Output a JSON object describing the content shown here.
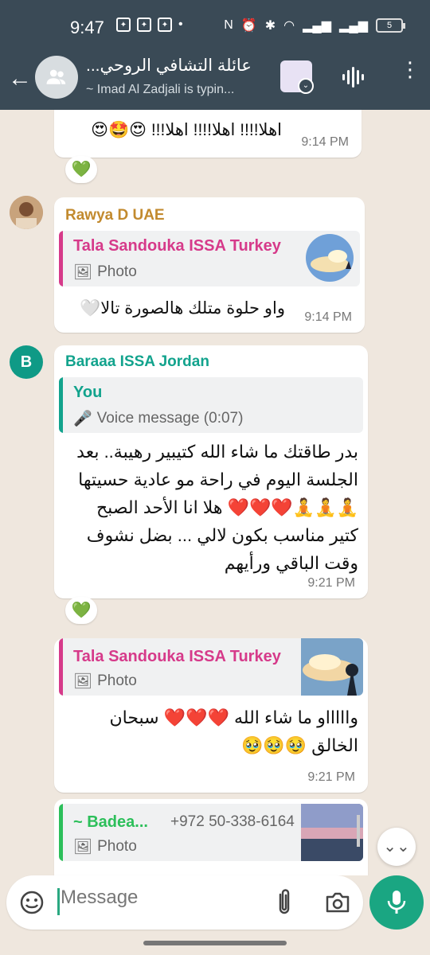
{
  "status_bar": {
    "time": "9:47",
    "battery": "5"
  },
  "header": {
    "title": "عائلة التشافي الروحي...",
    "subtitle": "~ Imad Al Zadjali is typin..."
  },
  "messages": [
    {
      "text": "اهلا!!!! اهلا!!!! اهلا!!! 😍🤩😍",
      "time": "9:14 PM",
      "reaction": "💚"
    },
    {
      "sender": "Rawya D UAE",
      "sender_color": "#c28a2e",
      "quote": {
        "name": "Tala Sandouka ISSA Turkey",
        "type_label": "Photo"
      },
      "text": "واو حلوة متلك هالصورة تالا🤍",
      "time": "9:14 PM"
    },
    {
      "sender": "Baraaa ISSA Jordan",
      "avatar_letter": "B",
      "sender_color": "#12a38d",
      "quote": {
        "name": "You",
        "type_label": "Voice message (0:07)"
      },
      "text": "بدر طاقتك ما شاء الله كتيبير رهيبة.. بعد الجلسة اليوم في راحة مو عادية حسيتها 🧘🧘🧘❤️❤️❤️ هلا انا الأحد الصبح كتير مناسب بكون لالي ... بضل نشوف وقت الباقي ورأيهم",
      "time": "9:21 PM",
      "reaction": "💚"
    },
    {
      "quote": {
        "name": "Tala Sandouka ISSA Turkey",
        "type_label": "Photo"
      },
      "text": "واااااو ما شاء الله ❤️❤️❤️ سبحان الخالق 🥹🥹🥹",
      "time": "9:21 PM"
    },
    {
      "quote": {
        "name": "~ Badea...",
        "phone": "+972 50-338-6164",
        "type_label": "Photo"
      }
    }
  ],
  "composer": {
    "placeholder": "Message"
  },
  "colors": {
    "header": "#3a4a56",
    "accent": "#1aa682",
    "quote_pink": "#d63a8a",
    "quote_green": "#12a38d",
    "quote_lime": "#2cbf5a"
  }
}
